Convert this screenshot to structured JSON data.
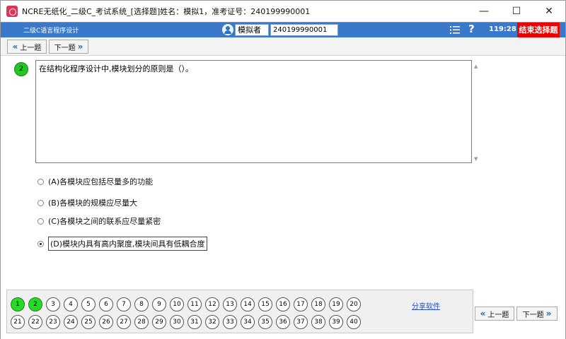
{
  "window": {
    "title": "NCRE无纸化_二级C_考试系统_[选择题]姓名：模拟1，准考证号：240199990001",
    "minimize": "—",
    "maximize": "☐",
    "close": "✕"
  },
  "header": {
    "subject": "二级C语言程序设计",
    "user_name": "模拟者",
    "exam_id": "240199990001",
    "help": "?",
    "timer": "119:28",
    "end_button": "结束选择题"
  },
  "toolbar": {
    "prev_label": "上一题",
    "next_label": "下一题"
  },
  "question": {
    "number": "2",
    "text": "在结构化程序设计中,模块划分的原则是（）。",
    "options": [
      {
        "label": "(A)各模块应包括尽量多的功能",
        "selected": false
      },
      {
        "label": "(B)各模块的规模应尽量大",
        "selected": false
      },
      {
        "label": "(C)各模块之间的联系应尽量紧密",
        "selected": false
      },
      {
        "label": "(D)模块内具有高内聚度,模块间具有低耦合度",
        "selected": true
      }
    ]
  },
  "question_grid": {
    "row1": [
      "1",
      "2",
      "3",
      "4",
      "5",
      "6",
      "7",
      "8",
      "9",
      "10",
      "11",
      "12",
      "13",
      "14",
      "15",
      "16",
      "17",
      "18",
      "19",
      "20"
    ],
    "row2": [
      "21",
      "22",
      "23",
      "24",
      "25",
      "26",
      "27",
      "28",
      "29",
      "30",
      "31",
      "32",
      "33",
      "34",
      "35",
      "36",
      "37",
      "38",
      "39",
      "40"
    ],
    "answered": [
      "1",
      "2"
    ],
    "share_link": "分享软件"
  },
  "bottom_nav": {
    "prev_label": "上一题",
    "next_label": "下一题"
  },
  "colors": {
    "header_blue": "#3a79c9",
    "end_red": "#ee0000",
    "answered_green": "#22dd22"
  }
}
